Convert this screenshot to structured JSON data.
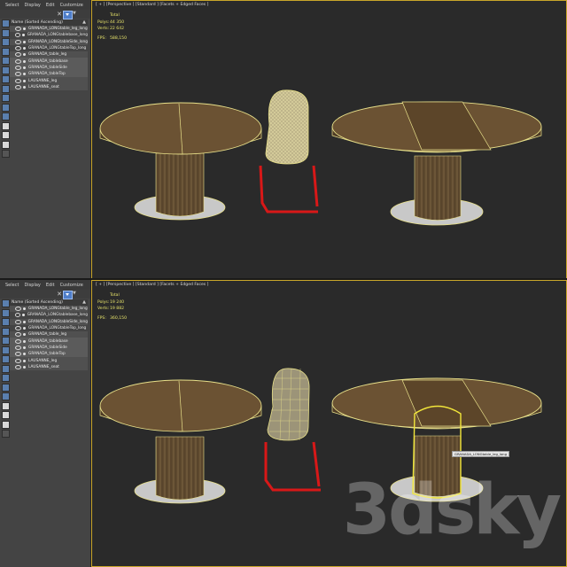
{
  "explorer_menu": [
    "Select",
    "Display",
    "Edit",
    "Customize"
  ],
  "list_header": "Name (Sorted Ascending)",
  "objects": [
    "GRANADA_LONGtable_leg_long",
    "GRANADA_LONGtablebase_long",
    "GRANADA_LONGtableSide_long",
    "GRANADA_LONGtableTop_long",
    "GRANADA_table_leg",
    "GRANADA_tablebase",
    "GRANADA_tableSide",
    "GRANADA_tableTop",
    "LAUSANNE_leg",
    "LAUSANNE_seat"
  ],
  "top": {
    "viewport_label": "[ + ] [Perspective ] [Standard ] [Facets + Edged Faces ]",
    "stats": {
      "header": "Total",
      "polys_label": "Polys:",
      "polys": "44 350",
      "verts_label": "Verts:",
      "verts": "22 642",
      "fps_label": "FPS:",
      "fps": "588,150"
    }
  },
  "bottom": {
    "viewport_label": "[ + ] [Perspective ] [Standard ] [Facets + Edged Faces ]",
    "stats": {
      "header": "Total",
      "polys_label": "Polys:",
      "polys": "19 240",
      "verts_label": "Verts:",
      "verts": "19 882",
      "fps_label": "FPS:",
      "fps": "360,150"
    },
    "tooltip": "GRANADA_LONGtable_leg_long"
  },
  "watermark": "3dsky",
  "colors": {
    "viewport_border": "#c9a62a",
    "stats_text": "#e7e36a",
    "wood": "#6b5233",
    "wireframe": "#e8e08a",
    "chair_frame": "#d81818",
    "selection": "#f2e63a"
  }
}
